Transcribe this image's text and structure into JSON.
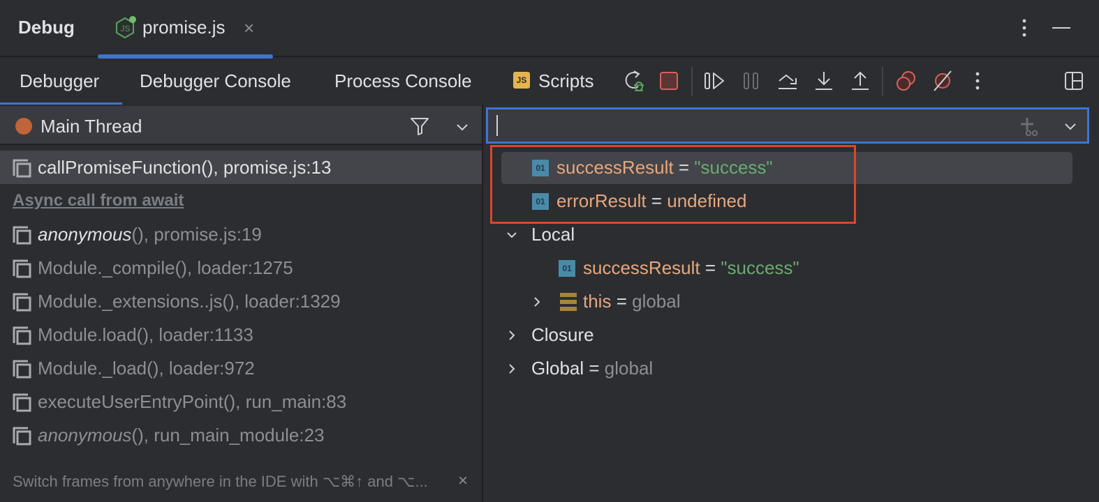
{
  "titlebar": {
    "app_title": "Debug",
    "file_tab": {
      "label": "promise.js",
      "close": "×",
      "icon": "nodejs-icon"
    },
    "actions": [
      {
        "icon": "kebab-icon"
      },
      {
        "icon": "minimize-icon"
      }
    ]
  },
  "tool_tabs": [
    {
      "label": "Debugger",
      "active": true
    },
    {
      "label": "Debugger Console",
      "active": false
    },
    {
      "label": "Process Console",
      "active": false
    },
    {
      "label": "Scripts",
      "badge": "JS",
      "active": false
    }
  ],
  "toolbar_buttons": [
    {
      "name": "rerun-debug",
      "icon": "rerun-debug-icon"
    },
    {
      "name": "stop",
      "icon": "stop-icon",
      "color": "#d9605a"
    },
    {
      "name": "resume",
      "icon": "resume-icon"
    },
    {
      "name": "pause",
      "icon": "pause-icon",
      "disabled": true
    },
    {
      "name": "step-over",
      "icon": "step-over-icon"
    },
    {
      "name": "step-into",
      "icon": "step-into-icon"
    },
    {
      "name": "step-out",
      "icon": "step-out-icon"
    },
    {
      "name": "view-breakpoints",
      "icon": "view-breakpoints-icon",
      "color": "#d9605a"
    },
    {
      "name": "mute-breakpoints",
      "icon": "mute-breakpoints-icon",
      "color": "#d9605a"
    },
    {
      "name": "more",
      "icon": "kebab-icon"
    },
    {
      "name": "layout",
      "icon": "layout-icon"
    }
  ],
  "frames_panel": {
    "thread": {
      "label": "Main Thread",
      "status_color": "#c0643a"
    },
    "selected_frame": {
      "func": "callPromiseFunction()",
      "location": ", promise.js:13"
    },
    "async_label": "Async call from await",
    "frames": [
      {
        "func": "anonymous",
        "suffix": "()",
        "location": ", promise.js:19",
        "italic": true,
        "bright": true
      },
      {
        "func": "Module._compile()",
        "suffix": "",
        "location": ", loader:1275",
        "italic": false,
        "bright": false
      },
      {
        "func": "Module._extensions..js()",
        "suffix": "",
        "location": ", loader:1329",
        "italic": false,
        "bright": false
      },
      {
        "func": "Module.load()",
        "suffix": "",
        "location": ", loader:1133",
        "italic": false,
        "bright": false
      },
      {
        "func": "Module._load()",
        "suffix": "",
        "location": ", loader:972",
        "italic": false,
        "bright": false
      },
      {
        "func": "executeUserEntryPoint()",
        "suffix": "",
        "location": ", run_main:83",
        "italic": false,
        "bright": false
      },
      {
        "func": "anonymous",
        "suffix": "()",
        "location": ", run_main_module:23",
        "italic": true,
        "bright": false
      }
    ],
    "hint": "Switch frames from anywhere in the IDE with ⌥⌘↑ and ⌥...",
    "hint_close": "×"
  },
  "variables_panel": {
    "eval_input": {
      "value": "",
      "placeholder": ""
    },
    "highlight_color": "#e0452a",
    "focus_color": "#3e74d6",
    "watches": [
      {
        "badge": "01",
        "name": "successResult",
        "eq": " = ",
        "value": "\"success\"",
        "type": "string"
      },
      {
        "badge": "01",
        "name": "errorResult",
        "eq": " = ",
        "value": "undefined",
        "type": "undefined"
      }
    ],
    "scopes": [
      {
        "label": "Local",
        "expanded": true,
        "children": [
          {
            "badge": "01",
            "name": "successResult",
            "eq": " = ",
            "value": "\"success\"",
            "type": "string"
          },
          {
            "icon": "object-icon",
            "name": "this",
            "eq": " = ",
            "value": "global",
            "type": "object",
            "expandable": true
          }
        ]
      },
      {
        "label": "Closure",
        "expanded": false
      },
      {
        "label": "Global",
        "eq": " = ",
        "value": "global",
        "expanded": false
      }
    ]
  }
}
